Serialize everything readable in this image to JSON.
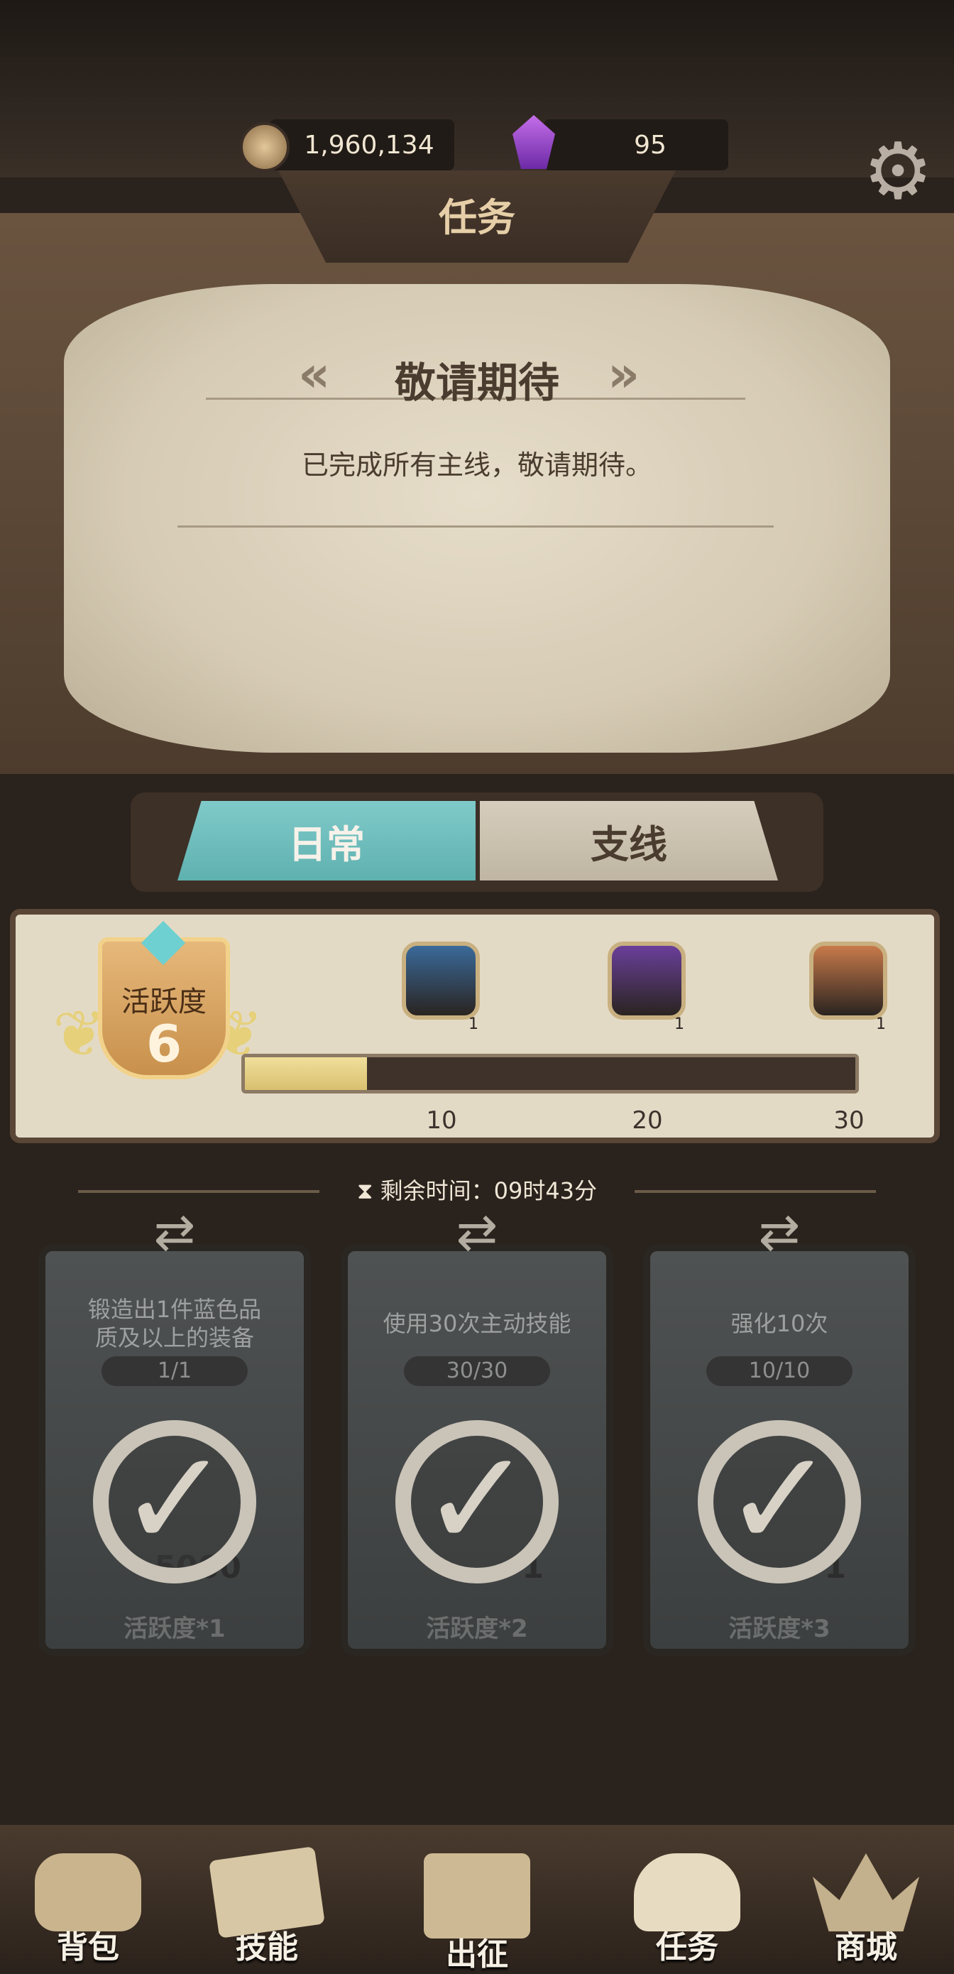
{
  "currency": {
    "coins": "1,960,134",
    "gems": "95",
    "coin_icon": "coin-icon",
    "gem_icon": "purple-gem-icon"
  },
  "page_title": "任务",
  "settings_icon": "gear-icon",
  "main_quest": {
    "title": "敬请期待",
    "description": "已完成所有主线，敬请期待。"
  },
  "tabs": [
    {
      "label": "日常",
      "active": true
    },
    {
      "label": "支线",
      "active": false
    }
  ],
  "activity": {
    "label": "活跃度",
    "value": "6",
    "max": 30,
    "progress_fraction": 0.2,
    "milestones": [
      {
        "value": "10",
        "chest_count": "1",
        "chest_color": "#3a6a9a"
      },
      {
        "value": "20",
        "chest_count": "1",
        "chest_color": "#6a3f9a"
      },
      {
        "value": "30",
        "chest_count": "1",
        "chest_color": "#c87a4a"
      }
    ]
  },
  "timer": "剩余时间：09时43分",
  "tasks": [
    {
      "desc_line1": "锻造出1件蓝色品",
      "desc_line2": "质及以上的装备",
      "progress": "1/1",
      "reward_qty": "5000",
      "reward_label": "活跃度*1",
      "completed": true
    },
    {
      "desc_line1": "使用30次主动技能",
      "desc_line2": "",
      "progress": "30/30",
      "reward_qty": "1",
      "reward_label": "活跃度*2",
      "completed": true
    },
    {
      "desc_line1": "强化10次",
      "desc_line2": "",
      "progress": "10/10",
      "reward_qty": "1",
      "reward_label": "活跃度*3",
      "completed": true
    }
  ],
  "nav": [
    {
      "label": "背包",
      "icon": "backpack-icon"
    },
    {
      "label": "技能",
      "icon": "skill-book-icon"
    },
    {
      "label": "出征",
      "icon": "sword-map-icon"
    },
    {
      "label": "任务",
      "icon": "scroll-icon"
    },
    {
      "label": "商城",
      "icon": "crown-shop-icon"
    }
  ],
  "colors": {
    "active_tab": "#6fbdbc",
    "progress_fill": "#e6d088",
    "card_bg": "#464949"
  }
}
